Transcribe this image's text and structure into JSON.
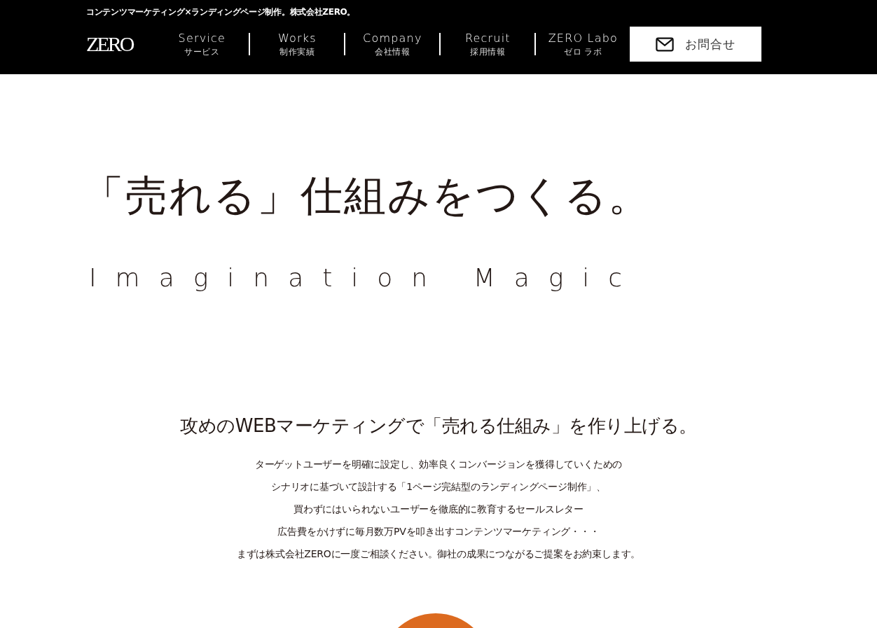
{
  "header": {
    "tagline": "コンテンツマーケティング×ランディングページ制作。株式会社ZERO。",
    "logo": "ZERO",
    "nav": [
      {
        "label": "Service",
        "sub": "サービス"
      },
      {
        "label": "Works",
        "sub": "制作実績"
      },
      {
        "label": "Company",
        "sub": "会社情報"
      },
      {
        "label": "Recruit",
        "sub": "採用情報"
      },
      {
        "label": "ZERO Labo",
        "sub": "ゼロ ラボ"
      }
    ],
    "contact_button": "お問合せ"
  },
  "hero": {
    "title": "「売れる」仕組みをつくる。",
    "subtitle": "Imagination Magic"
  },
  "intro": {
    "heading": "攻めのWEBマーケティングで「売れる仕組み」を作り上げる。",
    "lines": [
      "ターゲットユーザーを明確に設定し、効率良くコンバージョンを獲得していくための",
      "シナリオに基づいて設計する「1ページ完結型のランディングページ制作」、",
      "買わずにはいられないユーザーを徹底的に教育するセールスレター",
      "広告費をかけずに毎月数万PVを叩き出すコンテンツマーケティング・・・",
      "まずは株式会社ZEROに一度ご相談ください。御社の成果につながるご提案をお約束します。"
    ]
  }
}
